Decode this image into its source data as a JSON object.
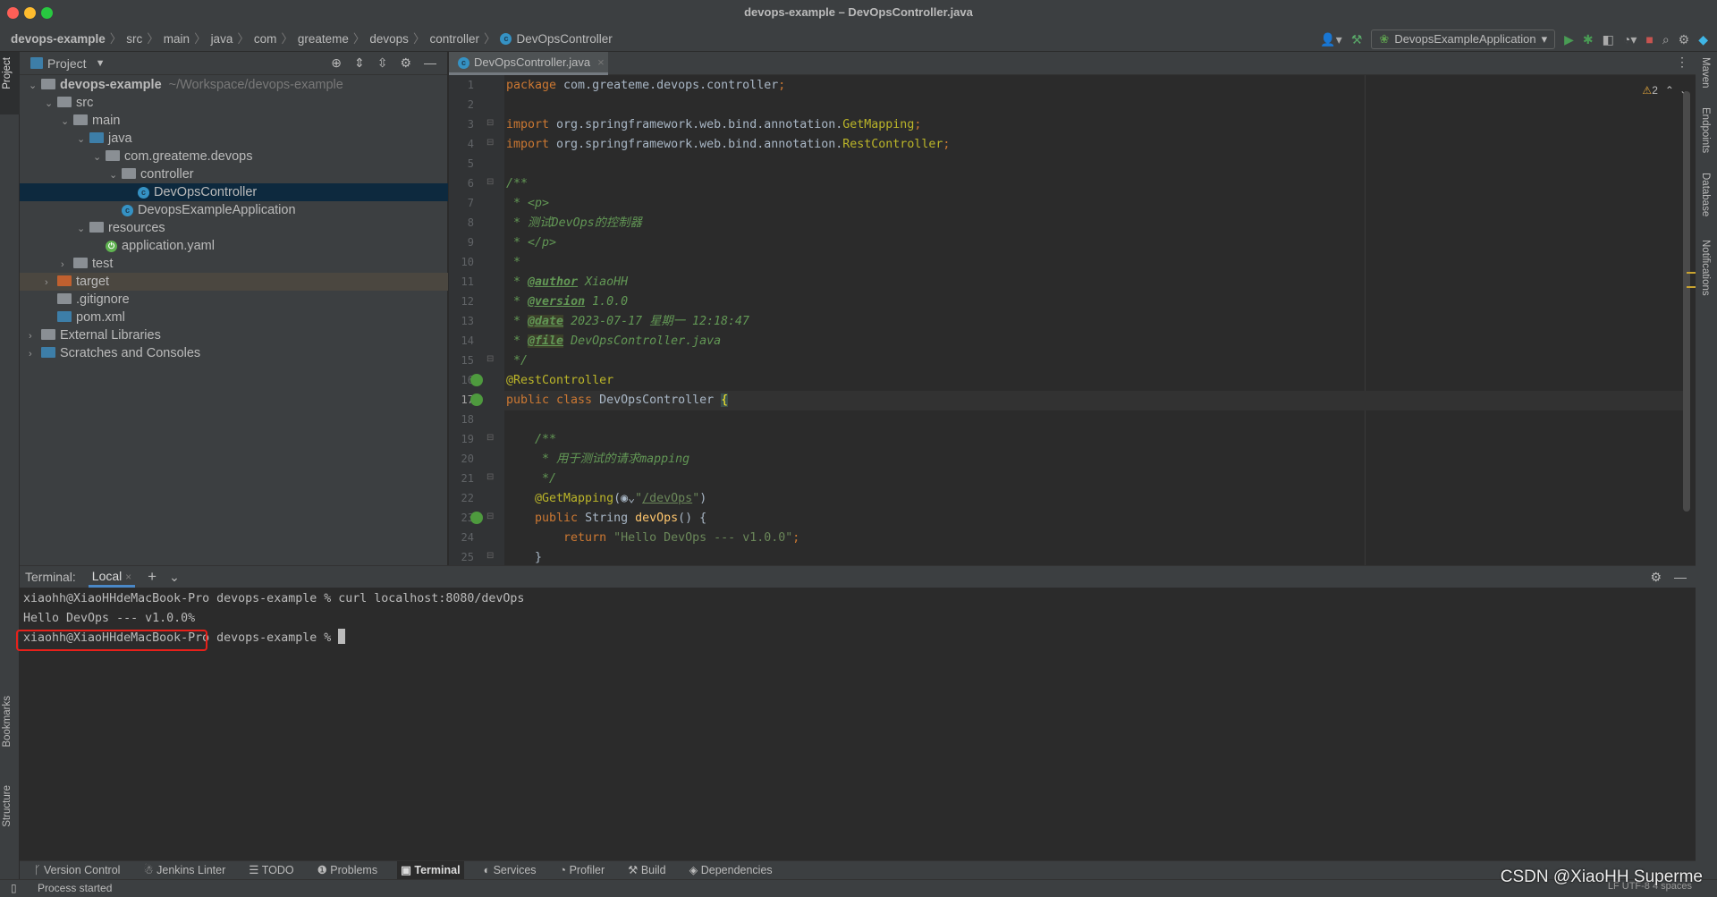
{
  "window": {
    "title": "devops-example – DevOpsController.java"
  },
  "breadcrumb": [
    "devops-example",
    "src",
    "main",
    "java",
    "com",
    "greateme",
    "devops",
    "controller",
    "DevOpsController"
  ],
  "toolbar": {
    "run_config": "DevopsExampleApplication"
  },
  "project": {
    "title": "Project",
    "tree": [
      {
        "label": "devops-example",
        "hint": "~/Workspace/devops-example",
        "depth": 0,
        "chev": "v",
        "icon": "module-folder",
        "bold": true
      },
      {
        "label": "src",
        "depth": 1,
        "chev": "v",
        "icon": "folder"
      },
      {
        "label": "main",
        "depth": 2,
        "chev": "v",
        "icon": "folder"
      },
      {
        "label": "java",
        "depth": 3,
        "chev": "v",
        "icon": "source-folder"
      },
      {
        "label": "com.greateme.devops",
        "depth": 4,
        "chev": "v",
        "icon": "package"
      },
      {
        "label": "controller",
        "depth": 5,
        "chev": "v",
        "icon": "package"
      },
      {
        "label": "DevOpsController",
        "depth": 6,
        "chev": "",
        "icon": "class",
        "selected": true
      },
      {
        "label": "DevopsExampleApplication",
        "depth": 5,
        "chev": "",
        "icon": "spring-app"
      },
      {
        "label": "resources",
        "depth": 3,
        "chev": "v",
        "icon": "resources-folder"
      },
      {
        "label": "application.yaml",
        "depth": 4,
        "chev": "",
        "icon": "spring-config"
      },
      {
        "label": "test",
        "depth": 2,
        "chev": ">",
        "icon": "folder"
      },
      {
        "label": "target",
        "depth": 1,
        "chev": ">",
        "icon": "excluded-folder",
        "excluded": true
      },
      {
        "label": ".gitignore",
        "depth": 1,
        "chev": "",
        "icon": "ignore-file"
      },
      {
        "label": "pom.xml",
        "depth": 1,
        "chev": "",
        "icon": "maven"
      },
      {
        "label": "External Libraries",
        "depth": 0,
        "chev": ">",
        "icon": "library"
      },
      {
        "label": "Scratches and Consoles",
        "depth": 0,
        "chev": ">",
        "icon": "scratches"
      }
    ]
  },
  "editor": {
    "tab": "DevOpsController.java",
    "warnings": "2",
    "current_line": 17,
    "lines": [
      [
        [
          "kw",
          "package "
        ],
        [
          "plain",
          "com.greateme.devops.controller"
        ],
        [
          "kw",
          ";"
        ]
      ],
      [],
      [
        [
          "kw",
          "import "
        ],
        [
          "plain",
          "org.springframework.web.bind.annotation."
        ],
        [
          "cls",
          "GetMapping"
        ],
        [
          "kw",
          ";"
        ]
      ],
      [
        [
          "kw",
          "import "
        ],
        [
          "plain",
          "org.springframework.web.bind.annotation."
        ],
        [
          "cls",
          "RestController"
        ],
        [
          "kw",
          ";"
        ]
      ],
      [],
      [
        [
          "doc",
          "/**"
        ]
      ],
      [
        [
          "doc",
          " * <p>"
        ]
      ],
      [
        [
          "doc",
          " * 测试DevOps的控制器"
        ]
      ],
      [
        [
          "doc",
          " * </p>"
        ]
      ],
      [
        [
          "doc",
          " *"
        ]
      ],
      [
        [
          "doc",
          " * "
        ],
        [
          "doctag",
          "@author"
        ],
        [
          "doc",
          " XiaoHH"
        ]
      ],
      [
        [
          "doc",
          " * "
        ],
        [
          "doctag",
          "@version"
        ],
        [
          "doc",
          " 1.0.0"
        ]
      ],
      [
        [
          "doc",
          " * "
        ],
        [
          "doctaghl",
          "@date"
        ],
        [
          "doc",
          " 2023-07-17 星期一 12:18:47"
        ]
      ],
      [
        [
          "doc",
          " * "
        ],
        [
          "doctaghl",
          "@file"
        ],
        [
          "doc",
          " DevOpsController.java"
        ]
      ],
      [
        [
          "doc",
          " */"
        ]
      ],
      [
        [
          "ann",
          "@RestController"
        ]
      ],
      [
        [
          "kw",
          "public class "
        ],
        [
          "plain",
          "DevOpsController "
        ],
        [
          "brace",
          "{"
        ]
      ],
      [],
      [
        [
          "doc",
          "    /**"
        ]
      ],
      [
        [
          "doc",
          "     * 用于测试的请求mapping"
        ]
      ],
      [
        [
          "doc",
          "     */"
        ]
      ],
      [
        [
          "ann",
          "    @GetMapping"
        ],
        [
          "plain",
          "("
        ],
        [
          "plain",
          "◉⌄"
        ],
        [
          "str",
          "\""
        ],
        [
          "url",
          "/devOps"
        ],
        [
          "str",
          "\""
        ],
        [
          "plain",
          ")"
        ]
      ],
      [
        [
          "kw",
          "    public "
        ],
        [
          "plain",
          "String "
        ],
        [
          "method",
          "devOps"
        ],
        [
          "plain",
          "() {"
        ]
      ],
      [
        [
          "kw",
          "        return "
        ],
        [
          "str",
          "\"Hello DevOps --- v1.0.0\""
        ],
        [
          "kw",
          ";"
        ]
      ],
      [
        [
          "plain",
          "    }"
        ]
      ]
    ]
  },
  "terminal": {
    "label": "Terminal:",
    "tab": "Local",
    "lines": [
      "xiaohh@XiaoHHdeMacBook-Pro devops-example % curl localhost:8080/devOps",
      "Hello DevOps --- v1.0.0%",
      "xiaohh@XiaoHHdeMacBook-Pro devops-example % "
    ]
  },
  "left_stripe": {
    "project": "Project",
    "bookmarks": "Bookmarks",
    "structure": "Structure"
  },
  "right_stripe": [
    "Maven",
    "Endpoints",
    "Database",
    "Notifications"
  ],
  "bottom_tabs": [
    {
      "label": "Version Control",
      "icon": "branch-icon"
    },
    {
      "label": "Jenkins Linter",
      "icon": "jenkins-icon"
    },
    {
      "label": "TODO",
      "icon": "list-icon"
    },
    {
      "label": "Problems",
      "icon": "problems-icon"
    },
    {
      "label": "Terminal",
      "icon": "terminal-icon",
      "active": true
    },
    {
      "label": "Services",
      "icon": "services-icon"
    },
    {
      "label": "Profiler",
      "icon": "profiler-icon"
    },
    {
      "label": "Build",
      "icon": "hammer-icon"
    },
    {
      "label": "Dependencies",
      "icon": "dependencies-icon"
    }
  ],
  "status": {
    "message": "Process started",
    "right": "LF  UTF-8  4 spaces"
  },
  "watermark": "CSDN @XiaoHH Superme"
}
